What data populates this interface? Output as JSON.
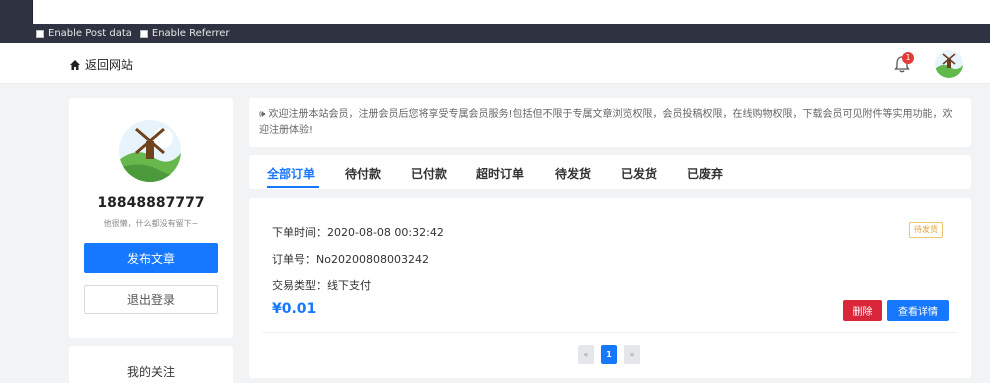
{
  "hackbar": {
    "options": [
      {
        "label": "Enable Post data"
      },
      {
        "label": "Enable Referrer"
      }
    ]
  },
  "header": {
    "back_label": "返回网站",
    "notification_count": "1"
  },
  "profile": {
    "name": "18848887777",
    "bio": "他很懒，什么都没有留下~",
    "publish_label": "发布文章",
    "logout_label": "退出登录",
    "follow_title": "我的关注"
  },
  "notice": {
    "text": "🕪 欢迎注册本站会员，注册会员后您将享受专属会员服务!包括但不限于专属文章浏览权限，会员投稿权限，在线购物权限，下载会员可见附件等实用功能，欢迎注册体验!"
  },
  "tabs": [
    {
      "label": "全部订单",
      "active": true
    },
    {
      "label": "待付款"
    },
    {
      "label": "已付款"
    },
    {
      "label": "超时订单"
    },
    {
      "label": "待发货"
    },
    {
      "label": "已发货"
    },
    {
      "label": "已废弃"
    }
  ],
  "order": {
    "time": "下单时间：2020-08-08 00:32:42",
    "number": "订单号：No20200808003242",
    "type": "交易类型：线下支付",
    "price": "¥0.01",
    "status": "待发货",
    "delete_label": "删除",
    "detail_label": "查看详情"
  },
  "pagination": {
    "prev": "«",
    "current": "1",
    "next": "»"
  },
  "colors": {
    "accent": "#1677ff",
    "danger": "#d9263a",
    "warning": "#e6a23c"
  }
}
